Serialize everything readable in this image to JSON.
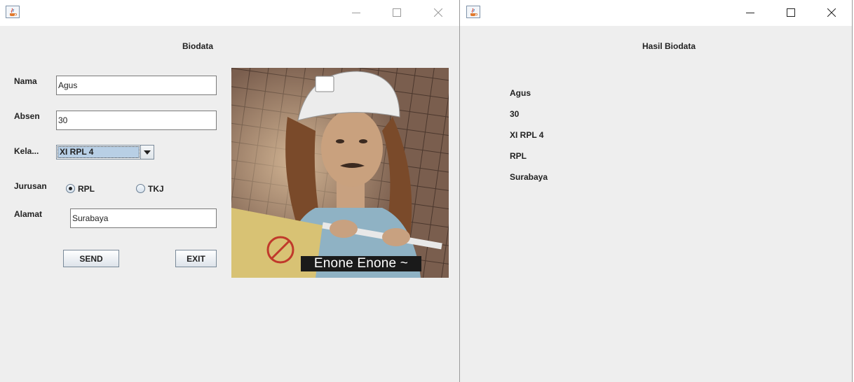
{
  "left_window": {
    "heading": "Biodata",
    "form": {
      "nama_label": "Nama",
      "nama_value": "Agus",
      "absen_label": "Absen",
      "absen_value": "30",
      "kelas_label": "Kela...",
      "kelas_value": "XI RPL 4",
      "jurusan_label": "Jurusan",
      "jurusan_options": [
        {
          "label": "RPL",
          "selected": true
        },
        {
          "label": "TKJ",
          "selected": false
        }
      ],
      "alamat_label": "Alamat",
      "alamat_value": "Surabaya"
    },
    "buttons": {
      "send": "SEND",
      "exit": "EXIT"
    },
    "image": {
      "caption": "Enone Enone ~",
      "icon": "meme-illustration"
    }
  },
  "right_window": {
    "heading": "Hasil Biodata",
    "results": [
      "Agus",
      "30",
      "XI RPL 4",
      "RPL",
      "Surabaya"
    ]
  },
  "icons": {
    "app": "java-app-icon",
    "minimize": "minimize-icon",
    "maximize": "maximize-icon",
    "close": "close-icon"
  },
  "colors": {
    "window_bg": "#eeeeee",
    "titlebar_bg": "#ffffff",
    "combo_selection": "#b8cfe5"
  }
}
